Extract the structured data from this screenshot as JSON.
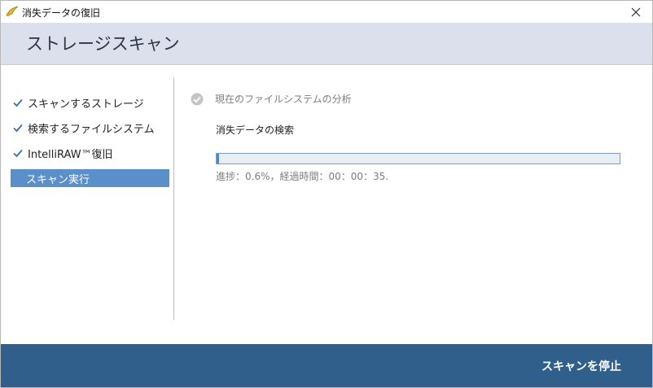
{
  "window": {
    "title": "消失データの復旧"
  },
  "header": {
    "title": "ストレージスキャン"
  },
  "sidebar": {
    "steps": [
      {
        "label": "スキャンするストレージ",
        "state": "done"
      },
      {
        "label": "検索するファイルシステム",
        "state": "done"
      },
      {
        "label": "IntelliRAW™復旧",
        "state": "done"
      },
      {
        "label": "スキャン実行",
        "state": "active"
      }
    ]
  },
  "content": {
    "analysis_label": "現在のファイルシステムの分析",
    "search_label": "消失データの検索",
    "progress": {
      "percent": 0.6,
      "text": "進捗：0.6%，経過時間：00：00：35."
    }
  },
  "footer": {
    "stop_label": "スキャンを停止"
  },
  "colors": {
    "header_bg": "#dcdfec",
    "active_step": "#5b8fca",
    "footer_bg": "#315f8b",
    "check": "#3d6fa8"
  }
}
